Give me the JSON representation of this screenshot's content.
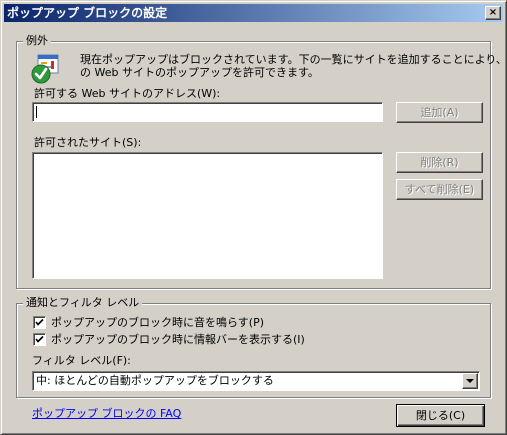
{
  "window": {
    "title": "ポップアップ ブロックの設定",
    "close_glyph": "×"
  },
  "exceptions": {
    "legend": "例外",
    "icon": "popup-shield-check-icon",
    "info_line1": "現在ポップアップはブロックされています。下の一覧にサイトを追加することにより、特定",
    "info_line2": "の Web サイトのポップアップを許可できます。",
    "address_label": "許可する Web サイトのアドレス(W):",
    "address_value": "",
    "add_button": "追加(A)",
    "allowed_label": "許可されたサイト(S):",
    "allowed_sites": [],
    "remove_button": "削除(R)",
    "remove_all_button": "すべて削除(E)"
  },
  "notification": {
    "legend": "通知とフィルタ レベル",
    "sound_checkbox": {
      "label": "ポップアップのブロック時に音を鳴らす(P)",
      "checked": true
    },
    "infobar_checkbox": {
      "label": "ポップアップのブロック時に情報バーを表示する(I)",
      "checked": true
    },
    "filter_label": "フィルタ レベル(F):",
    "filter_selected": "中: ほとんどの自動ポップアップをブロックする"
  },
  "footer": {
    "faq_link": "ポップアップ ブロックの FAQ",
    "close_button": "閉じる(C)"
  },
  "colors": {
    "title_start": "#0a246a",
    "title_end": "#a6caf0",
    "face": "#d4d0c8",
    "link": "#0000ff"
  }
}
